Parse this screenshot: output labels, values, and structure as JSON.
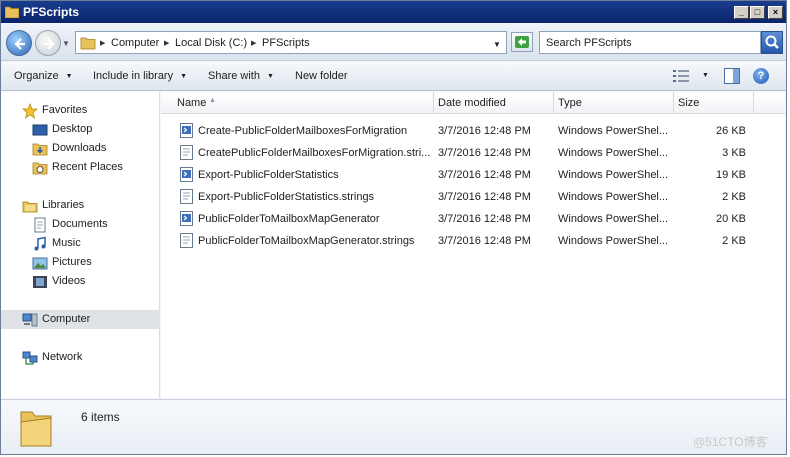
{
  "window": {
    "title": "PFScripts"
  },
  "address": {
    "breadcrumbs": [
      "Computer",
      "Local Disk (C:)",
      "PFScripts"
    ],
    "search_placeholder": "Search PFScripts"
  },
  "toolbar": {
    "organize": "Organize",
    "include_in_library": "Include in library",
    "share_with": "Share with",
    "new_folder": "New folder"
  },
  "navigation": {
    "favorites": "Favorites",
    "desktop": "Desktop",
    "downloads": "Downloads",
    "recent_places": "Recent Places",
    "libraries": "Libraries",
    "documents": "Documents",
    "music": "Music",
    "pictures": "Pictures",
    "videos": "Videos",
    "computer": "Computer",
    "network": "Network"
  },
  "columns": {
    "name": "Name",
    "date_modified": "Date modified",
    "type": "Type",
    "size": "Size"
  },
  "files": [
    {
      "name": "Create-PublicFolderMailboxesForMigration",
      "date": "3/7/2016 12:48 PM",
      "type": "Windows PowerShel...",
      "size": "26 KB",
      "icon": "powershell-script-icon"
    },
    {
      "name": "CreatePublicFolderMailboxesForMigration.stri...",
      "date": "3/7/2016 12:48 PM",
      "type": "Windows PowerShel...",
      "size": "3 KB",
      "icon": "strings-file-icon"
    },
    {
      "name": "Export-PublicFolderStatistics",
      "date": "3/7/2016 12:48 PM",
      "type": "Windows PowerShel...",
      "size": "19 KB",
      "icon": "powershell-script-icon"
    },
    {
      "name": "Export-PublicFolderStatistics.strings",
      "date": "3/7/2016 12:48 PM",
      "type": "Windows PowerShel...",
      "size": "2 KB",
      "icon": "strings-file-icon"
    },
    {
      "name": "PublicFolderToMailboxMapGenerator",
      "date": "3/7/2016 12:48 PM",
      "type": "Windows PowerShel...",
      "size": "20 KB",
      "icon": "powershell-script-icon"
    },
    {
      "name": "PublicFolderToMailboxMapGenerator.strings",
      "date": "3/7/2016 12:48 PM",
      "type": "Windows PowerShel...",
      "size": "2 KB",
      "icon": "strings-file-icon"
    }
  ],
  "status": {
    "item_count": "6 items"
  },
  "watermark": "@51CTO博客",
  "colors": {
    "title_bar": "#0a246a",
    "nav_selected": "#dfe3e8",
    "folder": "#e8c15a"
  }
}
